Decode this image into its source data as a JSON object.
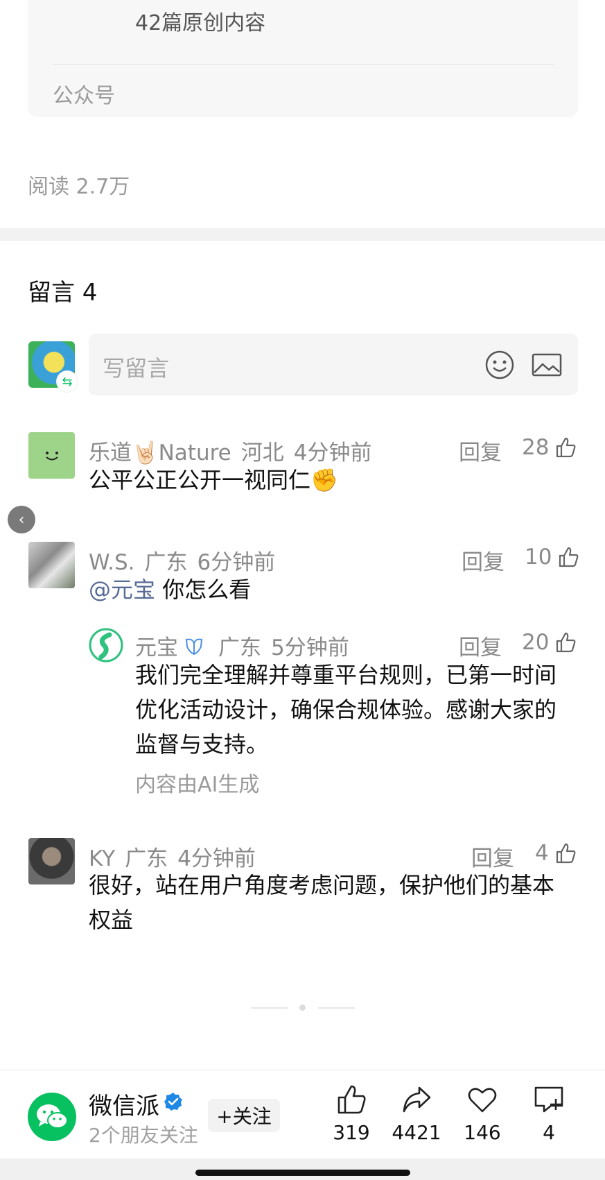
{
  "account_card": {
    "stats_line": "42篇原创内容",
    "type_label": "公众号"
  },
  "read_count": "阅读 2.7万",
  "comments": {
    "title": "留言 4",
    "input_placeholder": "写留言",
    "items": [
      {
        "name": "乐道🤘🏻Nature",
        "location": "河北",
        "time": "4分钟前",
        "reply_label": "回复",
        "likes": "28",
        "text": "公平公正公开一视同仁✊"
      },
      {
        "name": "W.S.",
        "location": "广东",
        "time": "6分钟前",
        "reply_label": "回复",
        "likes": "10",
        "mention": "@元宝",
        "text": " 你怎么看"
      },
      {
        "name": "KY",
        "location": "广东",
        "time": "4分钟前",
        "reply_label": "回复",
        "likes": "4",
        "text": "很好，站在用户角度考虑问题，保护他们的基本权益"
      }
    ],
    "ai_reply": {
      "name": "元宝",
      "location": "广东",
      "time": "5分钟前",
      "reply_label": "回复",
      "likes": "20",
      "text": "我们完全理解并尊重平台规则，已第一时间优化活动设计，确保合规体验。感谢大家的监督与支持。",
      "note": "内容由AI生成"
    }
  },
  "bottom_bar": {
    "account_name": "微信派",
    "followers_text": "2个朋友关注",
    "follow_label": "+关注",
    "likes": "319",
    "shares": "4421",
    "favorites": "146",
    "comments": "4"
  },
  "colors": {
    "brand_green": "#07c160",
    "mention_blue": "#576b95",
    "verify_blue": "#1e88e5"
  }
}
